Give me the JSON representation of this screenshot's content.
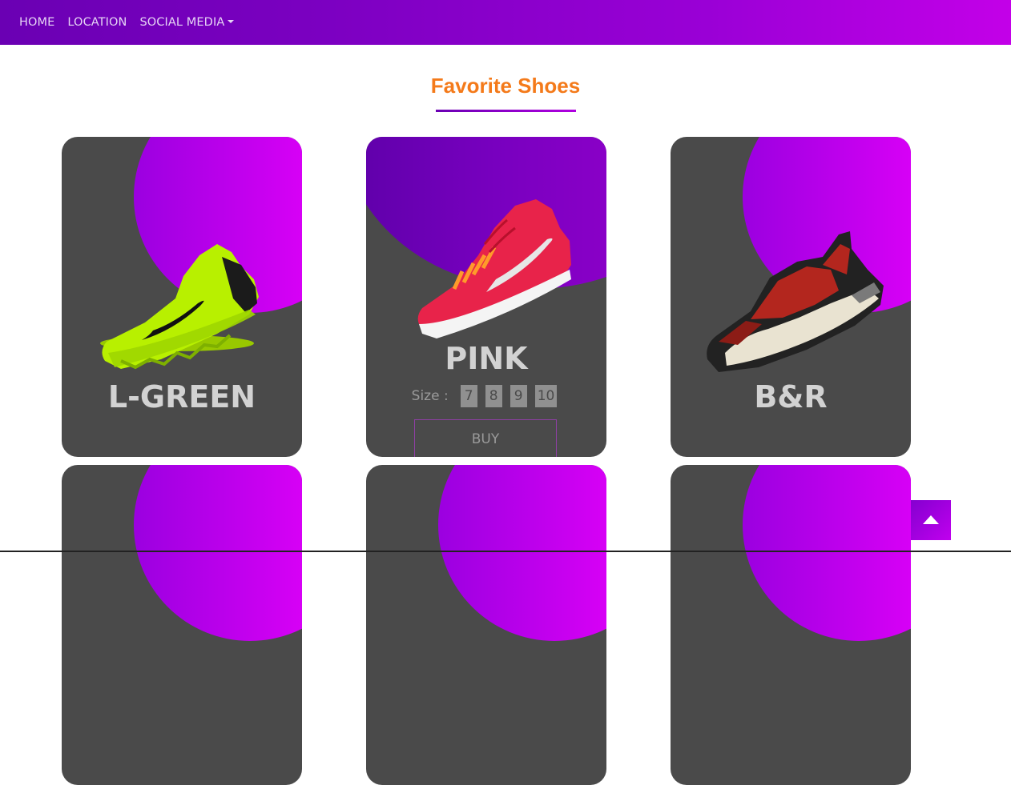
{
  "nav": {
    "items": [
      {
        "label": "HOME"
      },
      {
        "label": "LOCATION"
      },
      {
        "label": "SOCIAL MEDIA"
      }
    ]
  },
  "section": {
    "title": "Favorite Shoes"
  },
  "cards": [
    {
      "name": "L-GREEN",
      "shoe_color": "#b8f000"
    },
    {
      "name": "PINK",
      "shoe_color": "#e8234a",
      "size_label": "Size :",
      "sizes": [
        "7",
        "8",
        "9",
        "10"
      ],
      "buy_label": "BUY"
    },
    {
      "name": "B&R",
      "shoe_color": "#b3261e"
    }
  ],
  "colors": {
    "nav_gradient_start": "#6a00b3",
    "nav_gradient_end": "#c300e8",
    "title_color": "#f47a1a",
    "card_bg": "#4a4a4a"
  },
  "icons": {
    "scroll_top": "arrow-up-icon"
  }
}
